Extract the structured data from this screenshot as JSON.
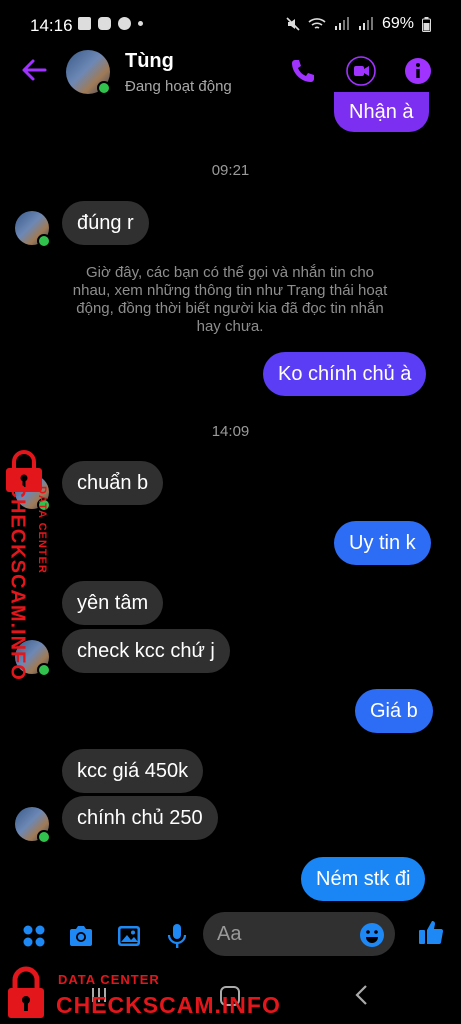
{
  "status_bar": {
    "time": "14:16",
    "battery": "69%"
  },
  "header": {
    "contact_name": "Tùng",
    "contact_status": "Đang hoạt động"
  },
  "messages": [
    {
      "text": "Nhận à",
      "side": "out"
    },
    {
      "text": "đúng r",
      "side": "in"
    },
    {
      "text": "Ko chính chủ à",
      "side": "out"
    },
    {
      "text": "chuẩn b",
      "side": "in"
    },
    {
      "text": "Uy tin k",
      "side": "out"
    },
    {
      "text": "yên tâm",
      "side": "in"
    },
    {
      "text": "check kcc chứ j",
      "side": "in"
    },
    {
      "text": "Giá b",
      "side": "out"
    },
    {
      "text": "kcc giá 450k",
      "side": "in"
    },
    {
      "text": "chính chủ 250",
      "side": "in"
    },
    {
      "text": "Ném stk đi",
      "side": "out"
    }
  ],
  "time_labels": [
    "09:21",
    "14:09"
  ],
  "system_note": "Giờ đây, các bạn có thể gọi và nhắn tin cho nhau, xem những thông tin như Trạng thái hoạt động, đồng thời biết người kia đã đọc tin nhắn hay chưa.",
  "composer": {
    "placeholder": "Aa"
  },
  "watermark": {
    "brand": "CHECKSCAM.INFO",
    "subtitle": "DATA CENTER",
    "color": "#e3161b"
  },
  "colors": {
    "accent": "#a033ff",
    "incoming": "#303030",
    "online": "#31c24d"
  }
}
